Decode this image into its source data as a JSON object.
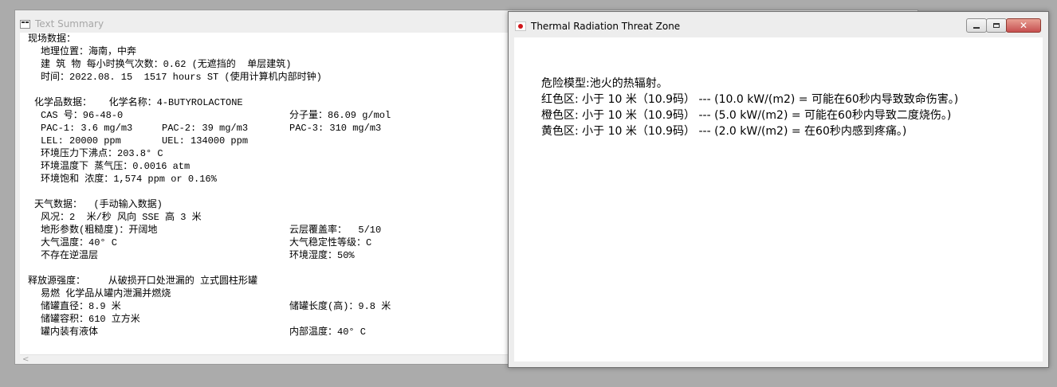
{
  "text_summary": {
    "title": "Text Summary",
    "lines": [
      {
        "text": "现场数据：",
        "indent": 10,
        "row": 0
      },
      {
        "text": "地理位置：海南，中奔",
        "indent": 26,
        "row": 1
      },
      {
        "text": "建 筑 物 每小时换气次数：0.62 (无遮挡的  单层建筑)",
        "indent": 26,
        "row": 2
      },
      {
        "text": "时间：2022.08. 15  1517 hours ST (使用计算机内部时钟)",
        "indent": 26,
        "row": 3
      },
      {
        "text": "化学品数据：   化学名称：4-BUTYROLACTONE",
        "indent": 18,
        "row": 5
      },
      {
        "text": "CAS 号：96-48-0",
        "indent": 26,
        "row": 6
      },
      {
        "text": "分子量：86.09 g/mol",
        "indent": 338,
        "row": 6
      },
      {
        "text": "PAC-1: 3.6 mg/m3",
        "indent": 26,
        "row": 7
      },
      {
        "text": "PAC-2: 39 mg/m3",
        "indent": 178,
        "row": 7
      },
      {
        "text": "PAC-3: 310 mg/m3",
        "indent": 338,
        "row": 7
      },
      {
        "text": "LEL: 20000 ppm",
        "indent": 26,
        "row": 8
      },
      {
        "text": "UEL: 134000 ppm",
        "indent": 178,
        "row": 8
      },
      {
        "text": "环境压力下沸点：203.8° C",
        "indent": 26,
        "row": 9
      },
      {
        "text": "环境温度下 蒸气压：0.0016 atm",
        "indent": 26,
        "row": 10
      },
      {
        "text": "环境饱和 浓度：1,574 ppm or 0.16%",
        "indent": 26,
        "row": 11
      },
      {
        "text": "天气数据：  (手动输入数据)",
        "indent": 18,
        "row": 13
      },
      {
        "text": "风况：2  米/秒 风向 SSE 高 3 米",
        "indent": 26,
        "row": 14
      },
      {
        "text": "地形参数(粗糙度)：开阔地",
        "indent": 26,
        "row": 15
      },
      {
        "text": "云层覆盖率：  5/10",
        "indent": 338,
        "row": 15
      },
      {
        "text": "大气温度：40° C",
        "indent": 26,
        "row": 16
      },
      {
        "text": "大气稳定性等级：C",
        "indent": 338,
        "row": 16
      },
      {
        "text": "不存在逆温层",
        "indent": 26,
        "row": 17
      },
      {
        "text": "环境湿度：50%",
        "indent": 338,
        "row": 17
      },
      {
        "text": "释放源强度：    从破损开口处泄漏的 立式圆柱形罐",
        "indent": 10,
        "row": 19
      },
      {
        "text": "易燃 化学品从罐内泄漏并燃烧",
        "indent": 26,
        "row": 20
      },
      {
        "text": "储罐直径：8.9 米",
        "indent": 26,
        "row": 21
      },
      {
        "text": "储罐长度(高)：9.8 米",
        "indent": 338,
        "row": 21
      },
      {
        "text": "储罐容积：610 立方米",
        "indent": 26,
        "row": 22
      },
      {
        "text": "罐内装有液体",
        "indent": 26,
        "row": 23
      },
      {
        "text": "内部温度：40° C",
        "indent": 338,
        "row": 23
      }
    ],
    "scroll_left_glyph": "<"
  },
  "threat_zone": {
    "title": "Thermal Radiation Threat Zone",
    "lines": [
      "危险模型:池火的热辐射。",
      "红色区: 小于 10 米（10.9码） --- (10.0 kW/(m2) = 可能在60秒内导致致命伤害。)",
      "橙色区: 小于 10 米（10.9码） --- (5.0 kW/(m2) = 可能在60秒内导致二度烧伤。)",
      "黄色区: 小于 10 米（10.9码） --- (2.0 kW/(m2) = 在60秒内感到疼痛。)"
    ],
    "close_glyph": "✕"
  }
}
